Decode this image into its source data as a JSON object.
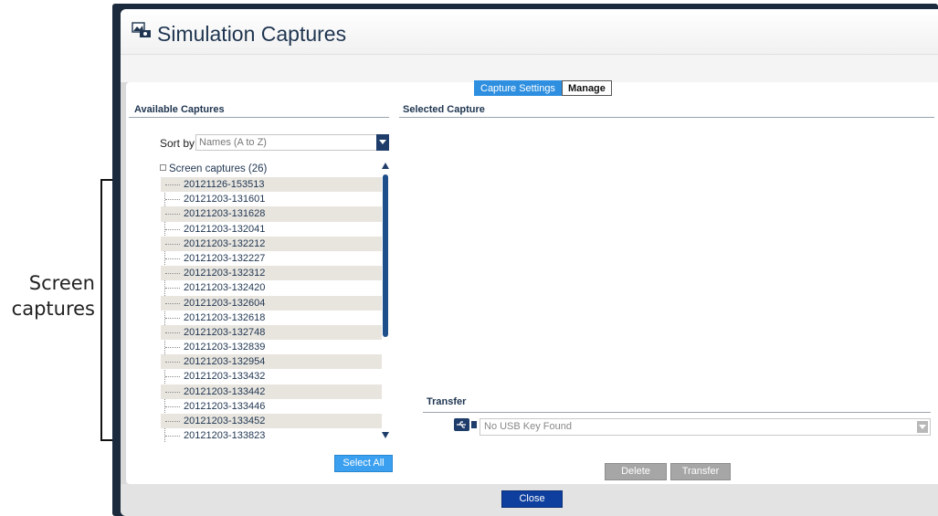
{
  "annotation": {
    "line1": "Screen",
    "line2": "captures"
  },
  "window": {
    "title": "Simulation Captures"
  },
  "tabs": [
    {
      "label": "Capture Settings",
      "active": true
    },
    {
      "label": "Manage",
      "active": false
    }
  ],
  "left_panel": {
    "heading": "Available Captures",
    "sort_label": "Sort by",
    "sort_value": "Names (A to Z)",
    "tree_root": "Screen captures (26)",
    "items": [
      "20121126-153513",
      "20121203-131601",
      "20121203-131628",
      "20121203-132041",
      "20121203-132212",
      "20121203-132227",
      "20121203-132312",
      "20121203-132420",
      "20121203-132604",
      "20121203-132618",
      "20121203-132748",
      "20121203-132839",
      "20121203-132954",
      "20121203-133432",
      "20121203-133442",
      "20121203-133446",
      "20121203-133452",
      "20121203-133823"
    ],
    "select_all_label": "Select All"
  },
  "right_panel": {
    "heading": "Selected Capture",
    "transfer_heading": "Transfer",
    "usb_value": "No USB Key Found",
    "delete_label": "Delete",
    "transfer_label": "Transfer"
  },
  "footer": {
    "close_label": "Close"
  },
  "colors": {
    "frame": "#1b2a3c",
    "accent_blue": "#3aa0ef",
    "dark_blue": "#1f3d6b",
    "close_button": "#0e3f9e",
    "row_stripe": "#e8e5df"
  },
  "icons": {
    "title": "image-capture-icon",
    "usb": "usb-icon"
  }
}
